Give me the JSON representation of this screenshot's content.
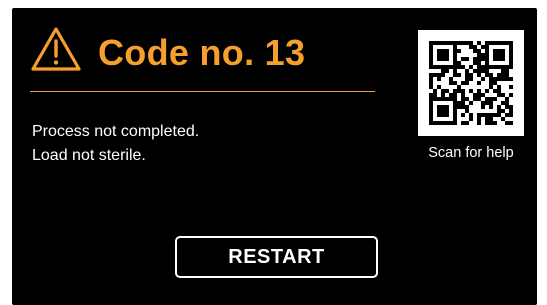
{
  "error": {
    "icon": "warning-triangle-icon",
    "title": "Code no. 13",
    "lines": [
      "Process not completed.",
      "Load not sterile."
    ]
  },
  "help": {
    "icon": "qr-code-icon",
    "caption": "Scan for help"
  },
  "actions": {
    "restart_label": "RESTART"
  },
  "colors": {
    "background": "#000000",
    "accent": "#f5a02e",
    "text": "#ffffff"
  }
}
